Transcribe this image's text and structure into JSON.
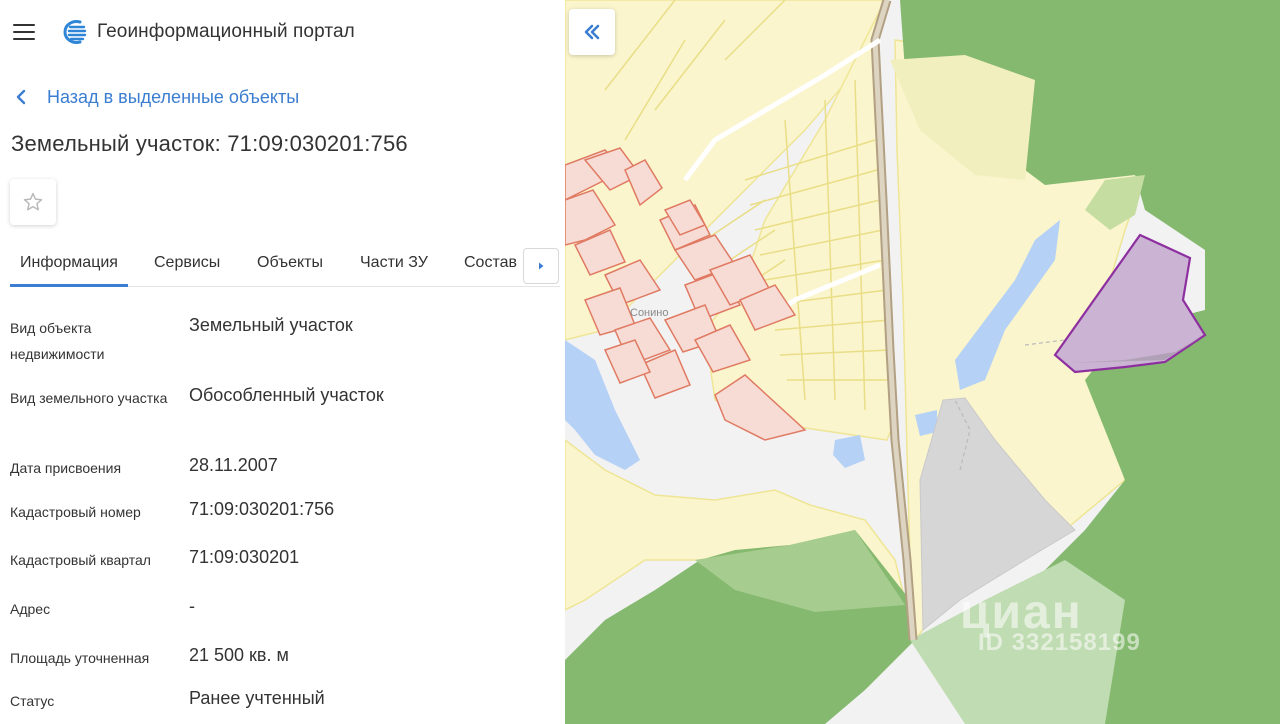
{
  "app": {
    "title": "Геоинформационный портал"
  },
  "nav": {
    "back_label": "Назад в выделенные объекты"
  },
  "object": {
    "title": "Земельный участок: 71:09:030201:756"
  },
  "tabs": [
    {
      "label": "Информация",
      "active": true
    },
    {
      "label": "Сервисы",
      "active": false
    },
    {
      "label": "Объекты",
      "active": false
    },
    {
      "label": "Части ЗУ",
      "active": false
    },
    {
      "label": "Состав",
      "active": false
    }
  ],
  "info": [
    {
      "label": "Вид объекта недвижимости",
      "value": "Земельный участок"
    },
    {
      "label": "Вид земельного участка",
      "value": "Обособленный участок"
    },
    {
      "label": "Дата присвоения",
      "value": "28.11.2007"
    },
    {
      "label": "Кадастровый номер",
      "value": "71:09:030201:756"
    },
    {
      "label": "Кадастровый квартал",
      "value": "71:09:030201"
    },
    {
      "label": "Адрес",
      "value": "-"
    },
    {
      "label": "Площадь уточненная",
      "value": "21 500 кв. м"
    },
    {
      "label": "Статус",
      "value": "Ранее учтенный"
    }
  ],
  "map": {
    "place_label": "Сонино",
    "watermark": {
      "brand": "циан",
      "id": "ID 332158199"
    }
  },
  "colors": {
    "accent": "#3b7dd0",
    "forest": "#85b96f",
    "parcel_yellow": "#faf5cc",
    "building_red": "#e07a63",
    "selected_parcel": "#cbb3d3",
    "water": "#b5d1f5"
  },
  "icons": {
    "menu": "hamburger-icon",
    "logo": "logo-icon",
    "back": "chevron-left-icon",
    "favorite": "star-outline-icon",
    "tabs_scroll": "triangle-right-icon",
    "collapse": "double-chevron-left-icon"
  }
}
